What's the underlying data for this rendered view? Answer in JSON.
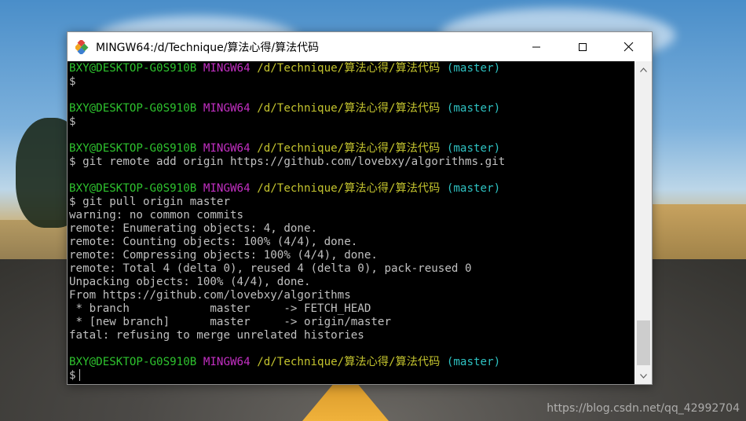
{
  "window": {
    "title": "MINGW64:/d/Technique/算法心得/算法代码"
  },
  "watermark": "https://blog.csdn.net/qq_42992704",
  "prompt": {
    "user": "BXY@DESKTOP-G0S910B",
    "system": "MINGW64",
    "path": "/d/Technique/算法心得/算法代码",
    "branch": "(master)"
  },
  "terminal_lines": [
    {
      "type": "prompt"
    },
    {
      "type": "cmd",
      "text": "$"
    },
    {
      "type": "blank"
    },
    {
      "type": "prompt"
    },
    {
      "type": "cmd",
      "text": "$"
    },
    {
      "type": "blank"
    },
    {
      "type": "prompt"
    },
    {
      "type": "cmd",
      "text": "$ git remote add origin https://github.com/lovebxy/algorithms.git"
    },
    {
      "type": "blank"
    },
    {
      "type": "prompt"
    },
    {
      "type": "cmd",
      "text": "$ git pull origin master"
    },
    {
      "type": "out",
      "text": "warning: no common commits"
    },
    {
      "type": "out",
      "text": "remote: Enumerating objects: 4, done."
    },
    {
      "type": "out",
      "text": "remote: Counting objects: 100% (4/4), done."
    },
    {
      "type": "out",
      "text": "remote: Compressing objects: 100% (4/4), done."
    },
    {
      "type": "out",
      "text": "remote: Total 4 (delta 0), reused 4 (delta 0), pack-reused 0"
    },
    {
      "type": "out",
      "text": "Unpacking objects: 100% (4/4), done."
    },
    {
      "type": "out",
      "text": "From https://github.com/lovebxy/algorithms"
    },
    {
      "type": "out",
      "text": " * branch            master     -> FETCH_HEAD"
    },
    {
      "type": "out",
      "text": " * [new branch]      master     -> origin/master"
    },
    {
      "type": "out",
      "text": "fatal: refusing to merge unrelated histories"
    },
    {
      "type": "blank"
    },
    {
      "type": "prompt"
    },
    {
      "type": "input",
      "text": "$"
    }
  ]
}
